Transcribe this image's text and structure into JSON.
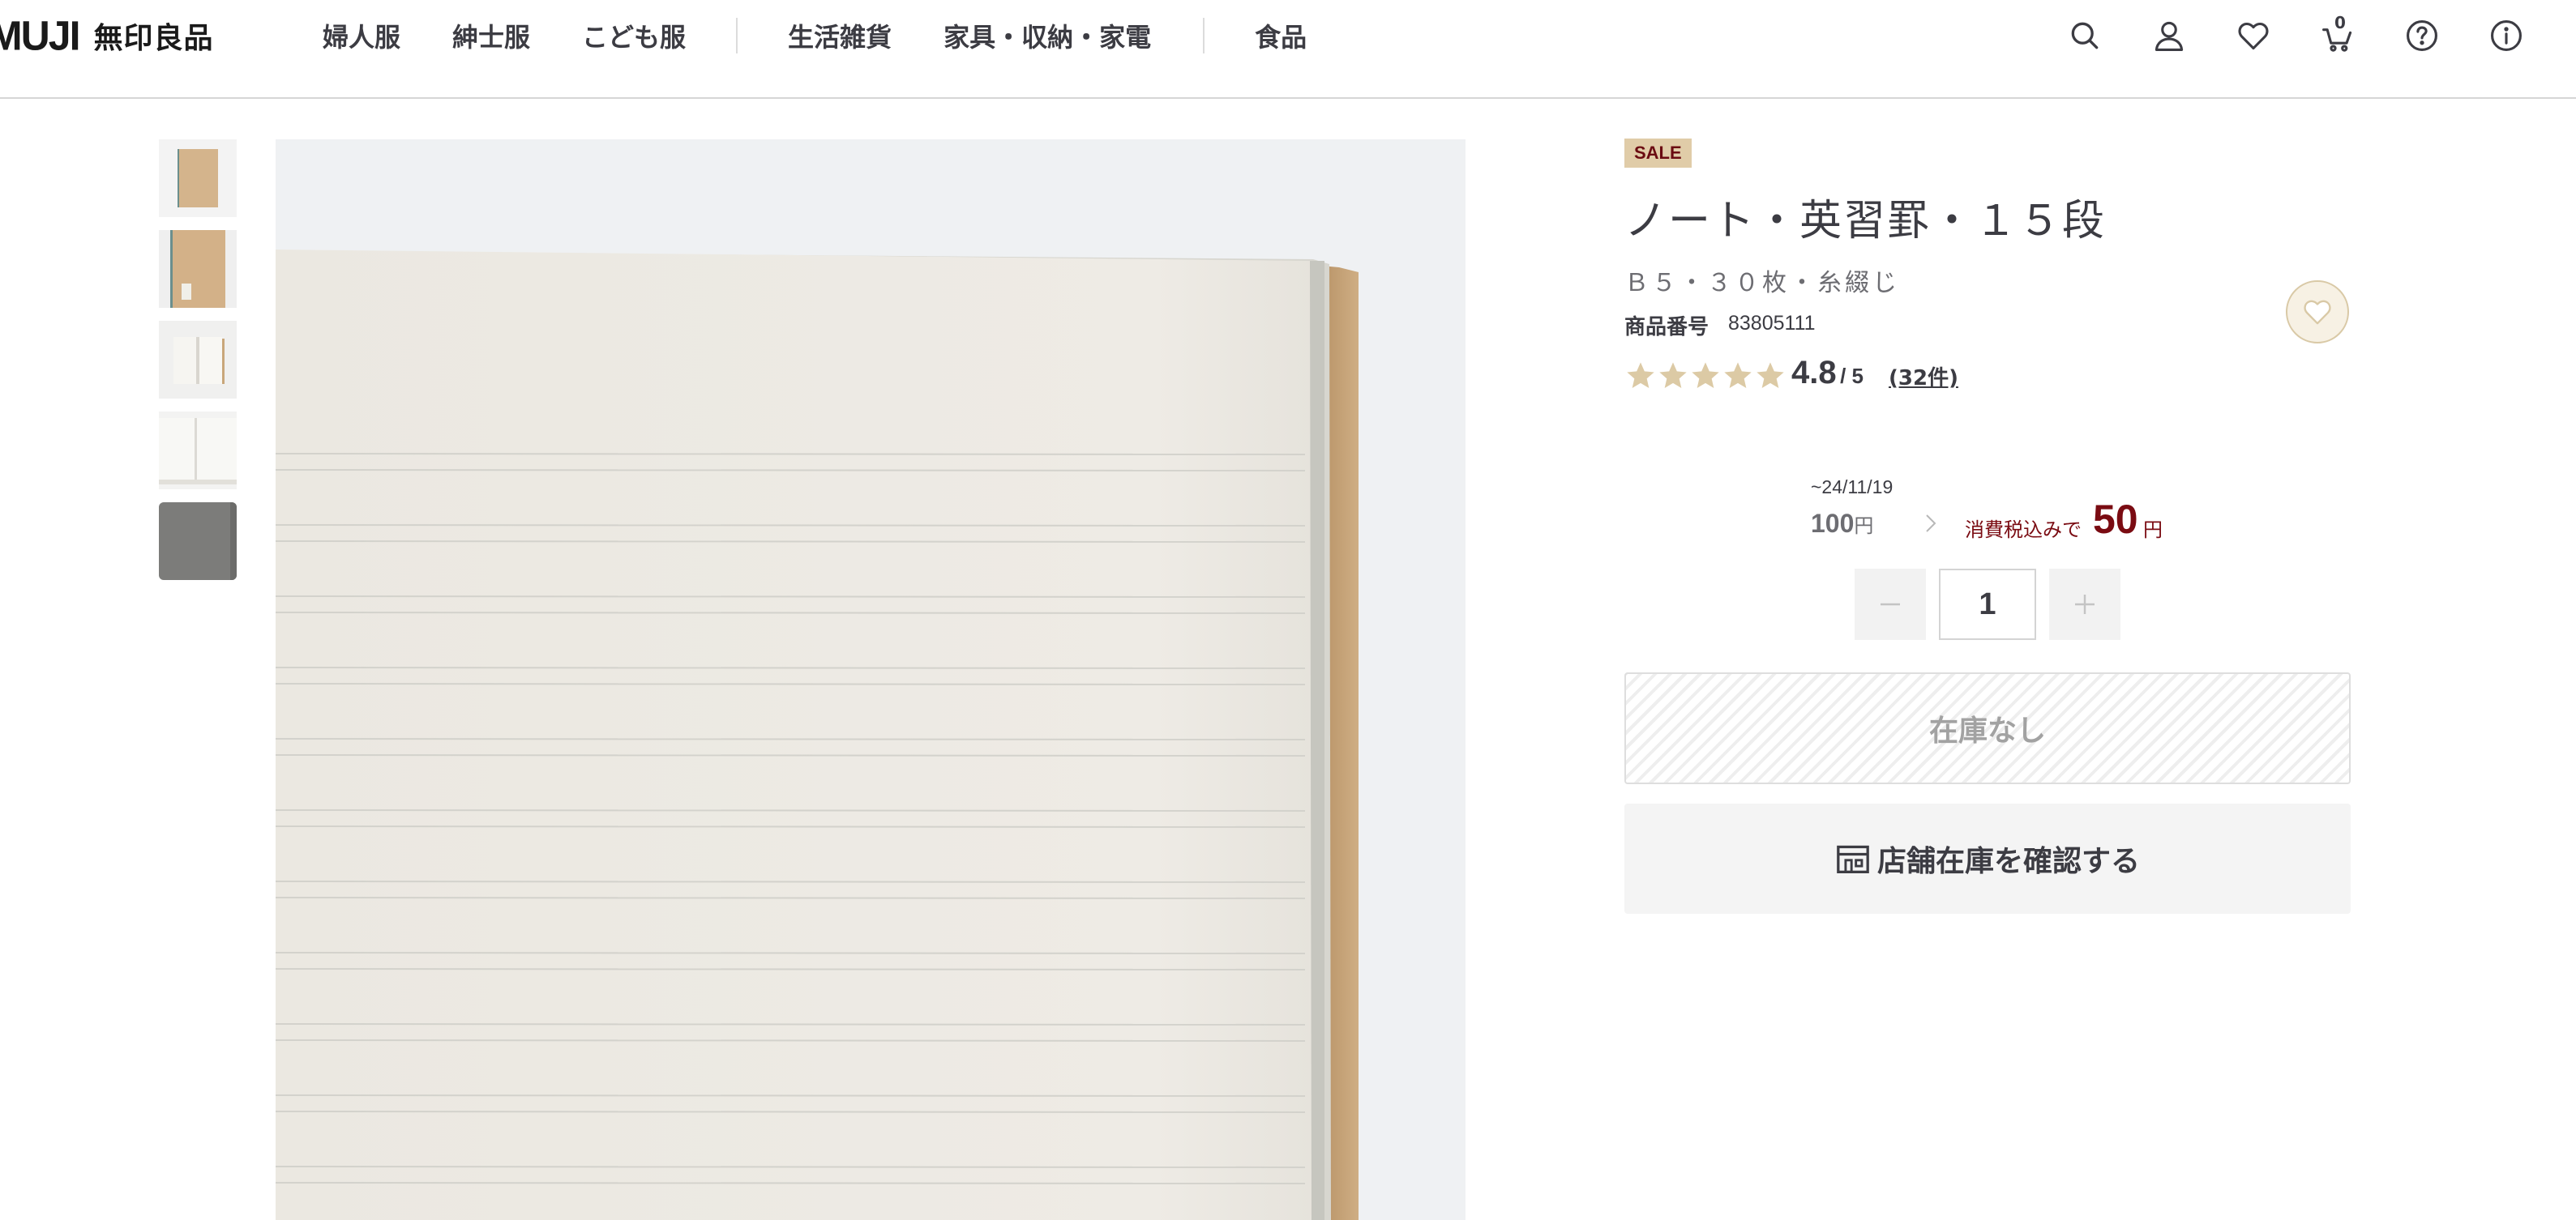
{
  "header": {
    "logo_en": "MUJI",
    "logo_ja": "無印良品",
    "nav": [
      "婦人服",
      "紳士服",
      "こども服",
      "生活雑貨",
      "家具・収納・家電",
      "食品"
    ],
    "cart_count": "0",
    "icons": [
      "search-icon",
      "account-icon",
      "heart-icon",
      "cart-icon",
      "help-icon",
      "info-icon"
    ]
  },
  "gallery": {
    "thumbnails": [
      "kraft-cover-front",
      "kraft-cover-label",
      "open-notebook",
      "open-notebook-side",
      "gray-cover"
    ]
  },
  "product": {
    "badge": "SALE",
    "title": "ノート・英習罫・１５段",
    "subtitle": "Ｂ５・３０枚・糸綴じ",
    "sku_label": "商品番号",
    "sku": "83805111",
    "rating": {
      "score": "4.8",
      "max": "/ 5",
      "stars_filled": 5,
      "reviews": "(32件)"
    },
    "price": {
      "until": "~24/11/19",
      "original": "100",
      "currency": "円",
      "tax_label": "消費税込みで",
      "sale": "50"
    },
    "quantity": "1",
    "stock_status": "在庫なし",
    "store_button": "店舗在庫を確認する"
  },
  "colors": {
    "sale_badge_bg": "#e0cca8",
    "sale_red": "#7a0b12",
    "star": "#dccaa5",
    "kraft": "#c9a67a"
  }
}
